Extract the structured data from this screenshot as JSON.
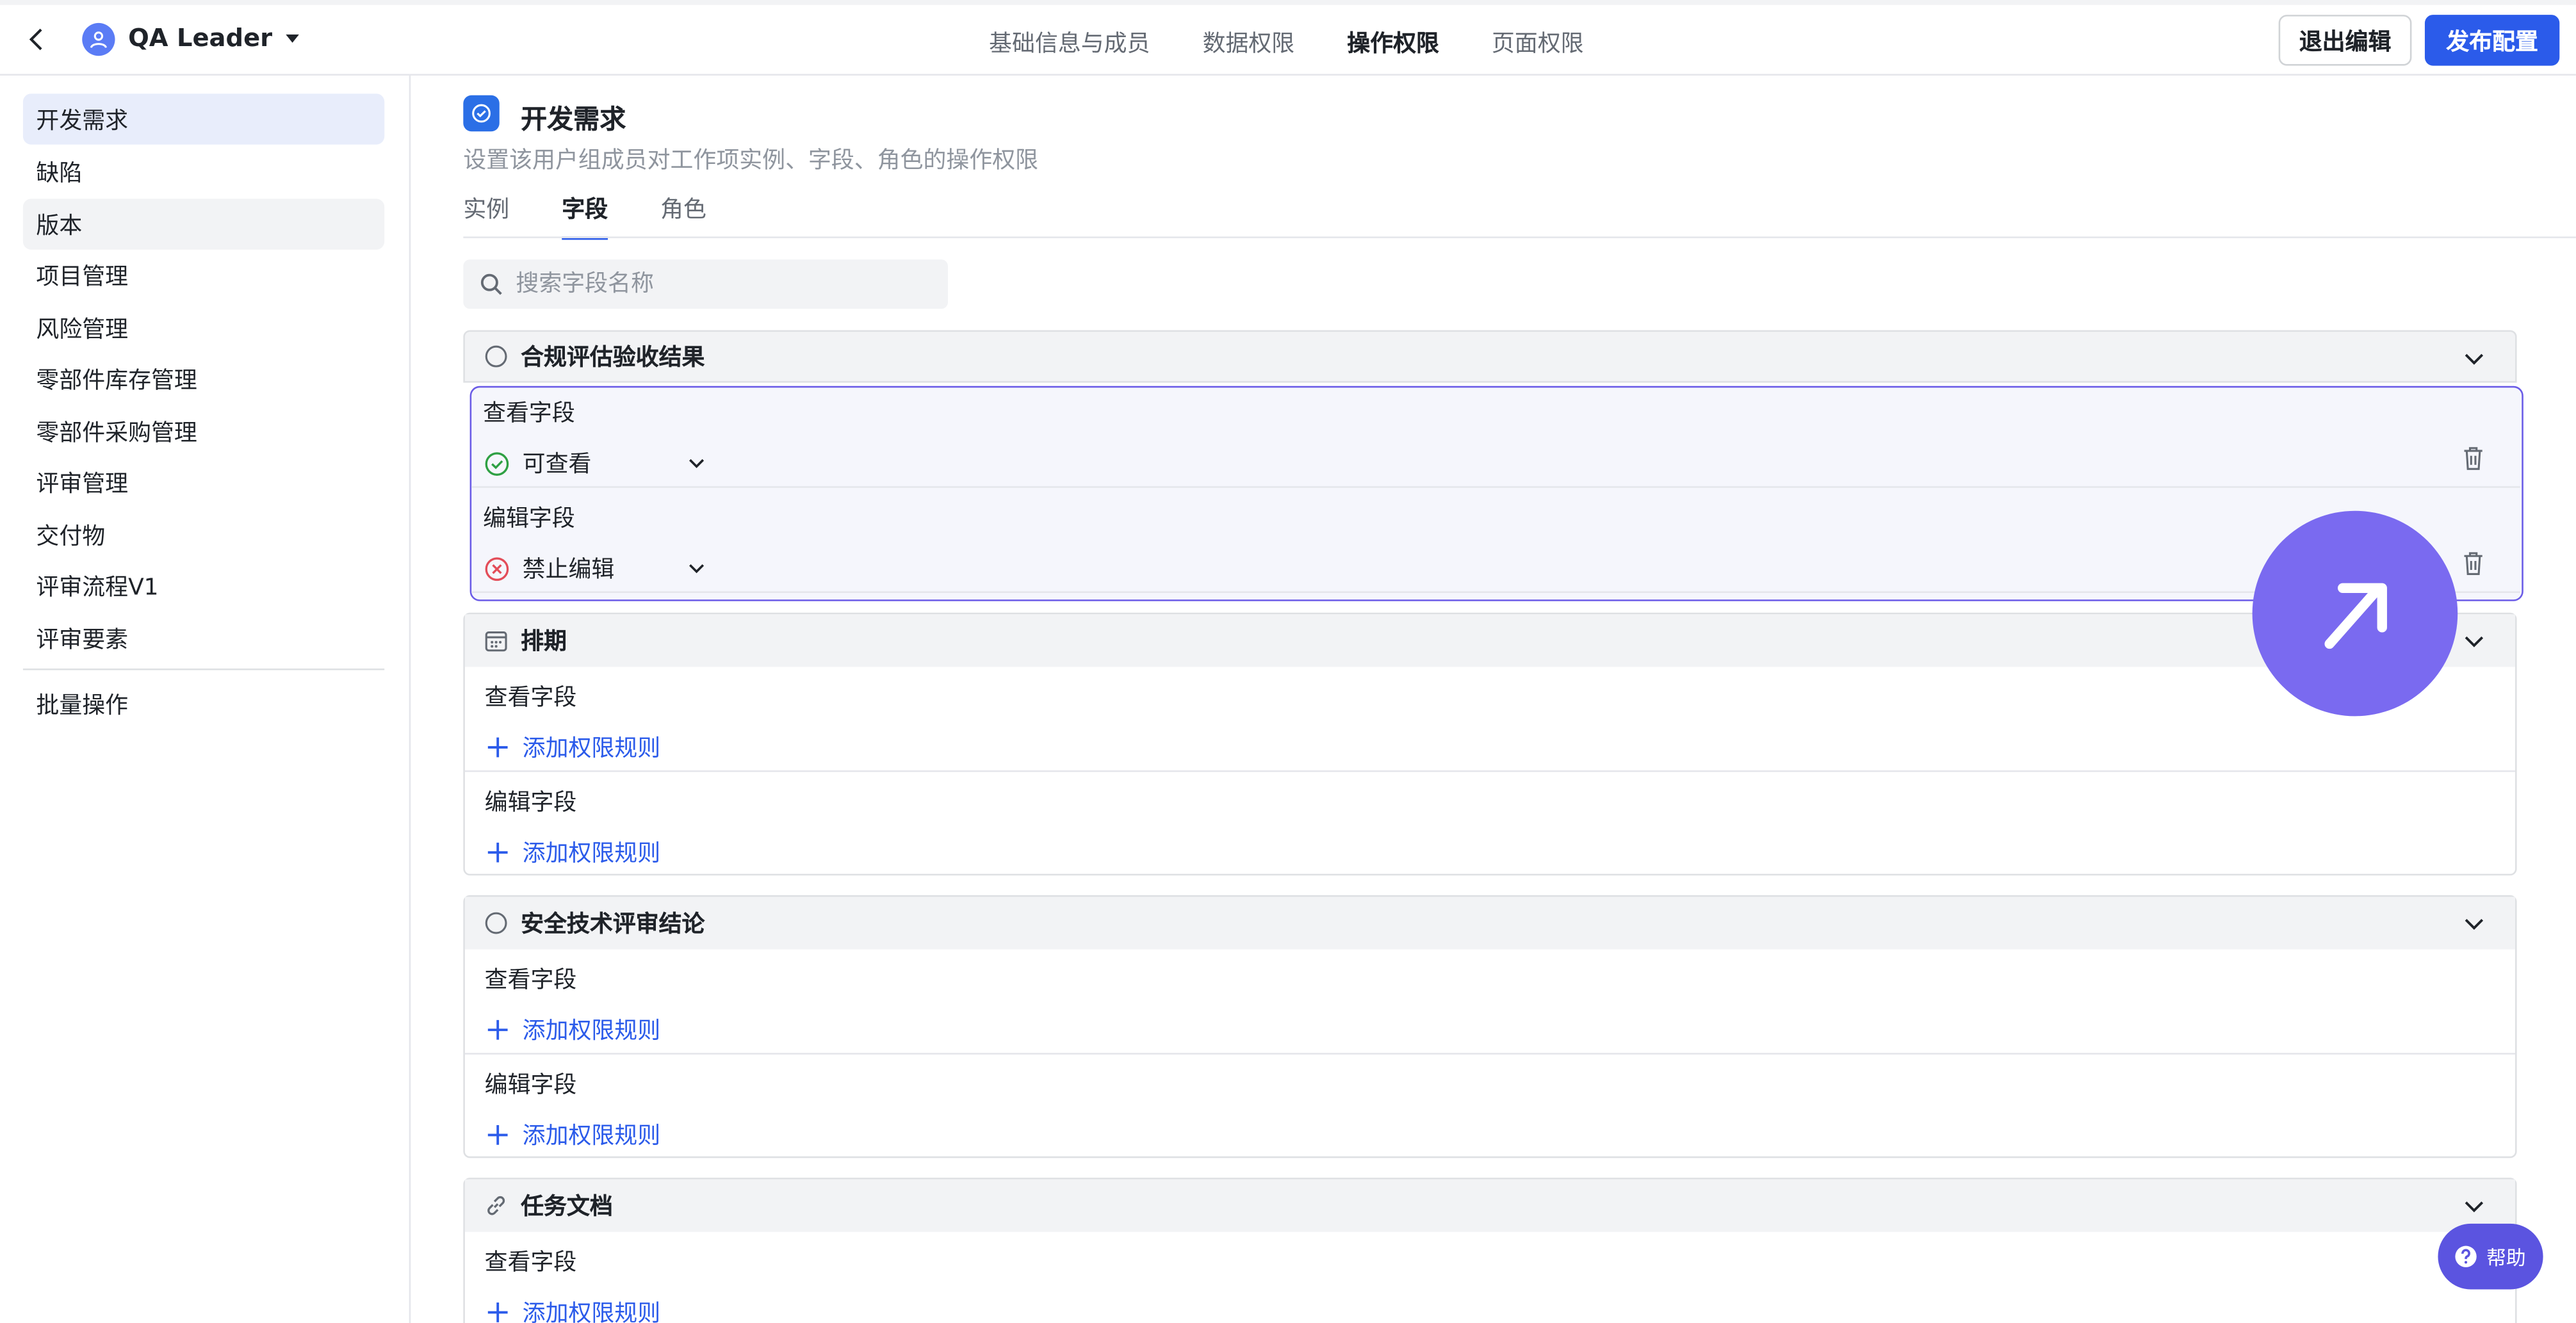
{
  "header": {
    "group_name": "QA Leader",
    "tabs": [
      "基础信息与成员",
      "数据权限",
      "操作权限",
      "页面权限"
    ],
    "active_tab": "操作权限",
    "exit_label": "退出编辑",
    "publish_label": "发布配置"
  },
  "sidebar": {
    "items": [
      "开发需求",
      "缺陷",
      "版本",
      "项目管理",
      "风险管理",
      "零部件库存管理",
      "零部件采购管理",
      "评审管理",
      "交付物",
      "评审流程V1",
      "评审要素"
    ],
    "batch": "批量操作"
  },
  "main": {
    "title": "开发需求",
    "subtitle": "设置该用户组成员对工作项实例、字段、角色的操作权限",
    "subtabs": [
      "实例",
      "字段",
      "角色"
    ],
    "active_subtab": "字段",
    "search_placeholder": "搜索字段名称"
  },
  "fields": [
    {
      "name": "合规评估验收结果",
      "view_label": "查看字段",
      "view_rule": "可查看",
      "edit_label": "编辑字段",
      "edit_rule": "禁止编辑"
    },
    {
      "name": "排期",
      "view_label": "查看字段",
      "view_add": "添加权限规则",
      "edit_label": "编辑字段",
      "edit_add": "添加权限规则"
    },
    {
      "name": "安全技术评审结论",
      "view_label": "查看字段",
      "view_add": "添加权限规则",
      "edit_label": "编辑字段",
      "edit_add": "添加权限规则"
    },
    {
      "name": "任务文档",
      "view_label": "查看字段",
      "view_add": "添加权限规则"
    }
  ],
  "help_label": "帮助",
  "colors": {
    "accent": "#2b5bea",
    "highlight": "#6b5ce7",
    "fab": "#7a6af0",
    "success": "#2ea043",
    "danger": "#e34d59"
  }
}
